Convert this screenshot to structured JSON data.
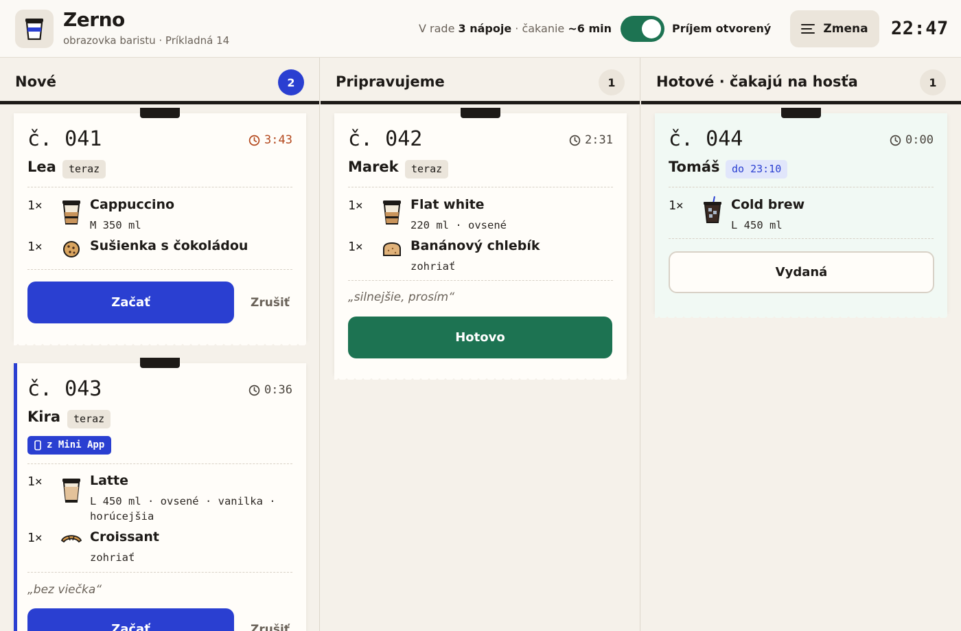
{
  "header": {
    "brand_name": "Zerno",
    "brand_sub": "obrazovka baristu · Príkladná 14",
    "queue_prefix": "V rade",
    "queue_count": "3 nápoje",
    "queue_mid": "· čakanie",
    "queue_wait": "~6 min",
    "toggle_on": true,
    "toggle_label": "Príjem otvorený",
    "shift_label": "Zmena",
    "clock": "22:47"
  },
  "colors": {
    "accent_blue": "#2a3fd1",
    "accent_green": "#1d7352",
    "warning": "#b3471c"
  },
  "columns": [
    {
      "title": "Nové",
      "count": "2",
      "tickets": [
        {
          "number": "č. 041",
          "timer": "3:43",
          "name": "Lea",
          "tag": "teraz",
          "items": [
            {
              "qty": "1×",
              "icon": "cup-icon",
              "name": "Cappuccino",
              "mods": "M 350 ml"
            },
            {
              "qty": "1×",
              "icon": "cookie-icon",
              "name": "Sušienka s čokoládou",
              "mods": ""
            }
          ],
          "primary": "Začať",
          "secondary": "Zrušiť"
        },
        {
          "number": "č. 043",
          "timer": "0:36",
          "name": "Kira",
          "tag": "teraz",
          "app_badge": "z Mini App",
          "items": [
            {
              "qty": "1×",
              "icon": "latte-cup-icon",
              "name": "Latte",
              "mods": "L 450 ml · ovsené · vanilka · horúcejšia"
            },
            {
              "qty": "1×",
              "icon": "croissant-icon",
              "name": "Croissant",
              "mods": "zohriať"
            }
          ],
          "note": "„bez viečka“",
          "primary": "Začať",
          "secondary": "Zrušiť"
        }
      ]
    },
    {
      "title": "Pripravujeme",
      "count": "1",
      "tickets": [
        {
          "number": "č. 042",
          "timer": "2:31",
          "name": "Marek",
          "tag": "teraz",
          "items": [
            {
              "qty": "1×",
              "icon": "cup-icon",
              "name": "Flat white",
              "mods": "220 ml · ovsené"
            },
            {
              "qty": "1×",
              "icon": "bread-icon",
              "name": "Banánový chlebík",
              "mods": "zohriať"
            }
          ],
          "note": "„silnejšie, prosím“",
          "primary": "Hotovo"
        }
      ]
    },
    {
      "title": "Hotové · čakajú na hosťa",
      "count": "1",
      "tickets": [
        {
          "number": "č. 044",
          "timer": "0:00",
          "name": "Tomáš",
          "tag": "do 23:10",
          "items": [
            {
              "qty": "1×",
              "icon": "iced-cup-icon",
              "name": "Cold brew",
              "mods": "L 450 ml"
            }
          ],
          "primary": "Vydaná"
        }
      ]
    }
  ]
}
